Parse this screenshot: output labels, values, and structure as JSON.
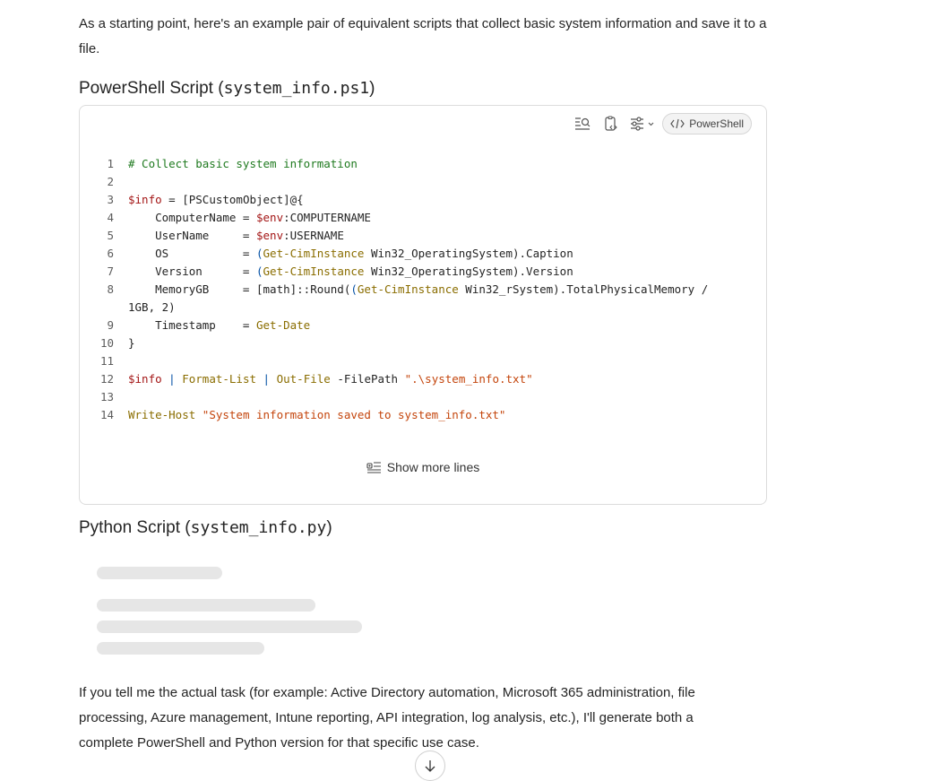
{
  "intro": "As a starting point, here's an example pair of equivalent scripts that collect basic system information and save it to a file.",
  "ps_heading": {
    "prefix": "PowerShell Script (",
    "code": "system_info.ps1",
    "suffix": ")"
  },
  "code_card": {
    "language": "PowerShell",
    "toolbar_icons": [
      "search-icon",
      "copy-icon",
      "settings-sliders-icon",
      "chevron-down-icon"
    ],
    "show_more": "Show more lines",
    "line_numbers": [
      "1",
      "2",
      "3",
      "4",
      "5",
      "6",
      "7",
      "8",
      "",
      "9",
      "10",
      "11",
      "12",
      "13",
      "14"
    ],
    "lines": [
      [
        {
          "t": "# Collect basic system information",
          "c": "c-com"
        }
      ],
      [],
      [
        {
          "t": "$info",
          "c": "c-var"
        },
        {
          "t": " = [PSCustomObject]@{",
          "c": ""
        }
      ],
      [
        {
          "t": "    ComputerName = ",
          "c": ""
        },
        {
          "t": "$env",
          "c": "c-var"
        },
        {
          "t": ":COMPUTERNAME",
          "c": ""
        }
      ],
      [
        {
          "t": "    UserName     = ",
          "c": ""
        },
        {
          "t": "$env",
          "c": "c-var"
        },
        {
          "t": ":USERNAME",
          "c": ""
        }
      ],
      [
        {
          "t": "    OS           = ",
          "c": ""
        },
        {
          "t": "(",
          "c": "c-blue"
        },
        {
          "t": "Get-CimInstance",
          "c": "c-cmd"
        },
        {
          "t": " Win32_OperatingSystem).Caption",
          "c": ""
        }
      ],
      [
        {
          "t": "    Version      = ",
          "c": ""
        },
        {
          "t": "(",
          "c": "c-blue"
        },
        {
          "t": "Get-CimInstance",
          "c": "c-cmd"
        },
        {
          "t": " Win32_OperatingSystem).Version",
          "c": ""
        }
      ],
      [
        {
          "t": "    MemoryGB     = [math]::Round(",
          "c": ""
        },
        {
          "t": "(",
          "c": "c-blue"
        },
        {
          "t": "Get-CimInstance",
          "c": "c-cmd"
        },
        {
          "t": " Win32_rSystem).TotalPhysicalMemory /",
          "c": ""
        }
      ],
      [
        {
          "t": "1GB, 2)",
          "c": ""
        }
      ],
      [
        {
          "t": "    Timestamp    = ",
          "c": ""
        },
        {
          "t": "Get-Date",
          "c": "c-cmd"
        }
      ],
      [
        {
          "t": "}",
          "c": ""
        }
      ],
      [],
      [
        {
          "t": "$info",
          "c": "c-var"
        },
        {
          "t": " | ",
          "c": "c-blue"
        },
        {
          "t": "Format-List",
          "c": "c-cmd"
        },
        {
          "t": " | ",
          "c": "c-blue"
        },
        {
          "t": "Out-File",
          "c": "c-cmd"
        },
        {
          "t": " -FilePath ",
          "c": ""
        },
        {
          "t": "\".\\system_info.txt\"",
          "c": "c-str"
        }
      ],
      [],
      [
        {
          "t": "Write-Host",
          "c": "c-cmd"
        },
        {
          "t": " \"System information saved to system_info.txt\"",
          "c": "c-str"
        }
      ]
    ]
  },
  "py_heading": {
    "prefix": "Python Script (",
    "code": "system_info.py",
    "suffix": ")"
  },
  "outro": "If you tell me the actual task (for example: Active Directory automation, Microsoft 365 administration, file processing, Azure management, Intune reporting, API integration, log analysis, etc.), I'll generate both a complete PowerShell and Python version for that specific use case.",
  "scroll_button_icon": "arrow-down-icon"
}
